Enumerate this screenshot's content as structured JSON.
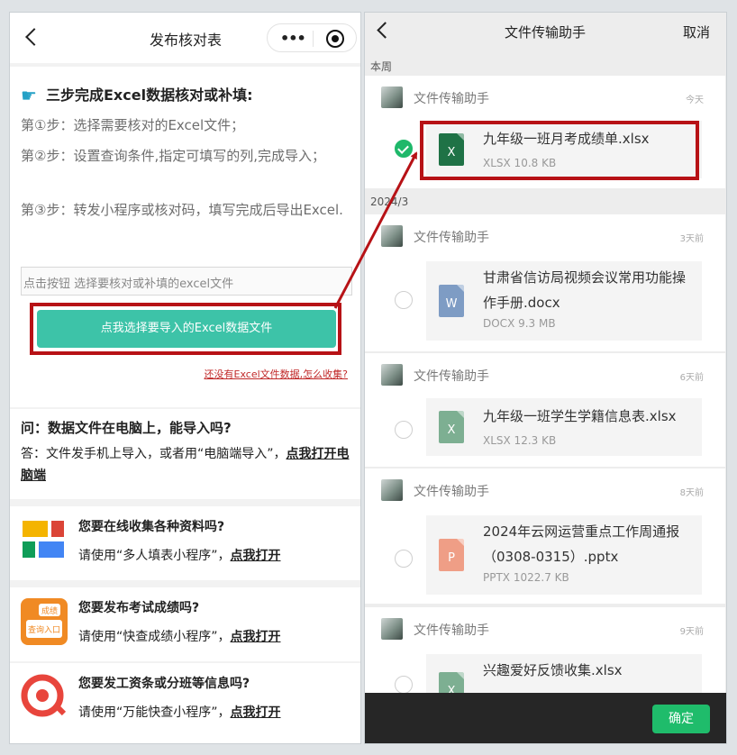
{
  "left": {
    "title": "发布核对表",
    "capsule_dots": "•••",
    "steps_title": "三步完成Excel数据核对或补填:",
    "steps": [
      "第①步：选择需要核对的Excel文件；",
      "第②步：设置查询条件,指定可填写的列,完成导入；",
      "第③步：转发小程序或核对码，填写完成后导出Excel."
    ],
    "file_placeholder": "点击按钮 选择要核对或补填的excel文件",
    "import_button": "点我选择要导入的Excel数据文件",
    "help_link": "还没有Excel文件数据,怎么收集?",
    "faq": {
      "question": "问：数据文件在电脑上，能导入吗?",
      "answer_prefix": "答：文件发手机上导入，或者用“电脑端导入”，",
      "answer_link": "点我打开电脑端"
    },
    "promos": [
      {
        "title": "您要在线收集各种资料吗?",
        "desc": "请使用“多人填表小程序”，",
        "link": "点我打开"
      },
      {
        "title": "您要发布考试成绩吗?",
        "desc": "请使用“快查成绩小程序”，",
        "link": "点我打开",
        "icon_text": "成绩",
        "icon_sub": "查询入口"
      },
      {
        "title": "您要发工资条或分班等信息吗?",
        "desc": "请使用“万能快查小程序”，",
        "link": "点我打开"
      }
    ]
  },
  "right": {
    "title": "文件传输助手",
    "cancel": "取消",
    "confirm": "确定",
    "sections": [
      "本周",
      "2024/3"
    ],
    "messages": [
      {
        "sender": "文件传输助手",
        "time": "今天",
        "file": "九年级一班月考成绩单.xlsx",
        "meta": "XLSX 10.8 KB",
        "icon": "X",
        "selected": true
      },
      {
        "sender": "文件传输助手",
        "time": "3天前",
        "file": "甘肃省信访局视频会议常用功能操作手册.docx",
        "meta": "DOCX 9.3 MB",
        "icon": "W",
        "selected": false
      },
      {
        "sender": "文件传输助手",
        "time": "6天前",
        "file": "九年级一班学生学籍信息表.xlsx",
        "meta": "XLSX 12.3 KB",
        "icon": "X",
        "selected": false
      },
      {
        "sender": "文件传输助手",
        "time": "8天前",
        "file": "2024年云网运营重点工作周通报（0308-0315）.pptx",
        "meta": "PPTX 1022.7 KB",
        "icon": "P",
        "selected": false
      },
      {
        "sender": "文件传输助手",
        "time": "9天前",
        "file": "兴趣爱好反馈收集.xlsx",
        "meta": "",
        "icon": "X",
        "selected": false
      }
    ]
  },
  "colors": {
    "accent_green": "#3dc3a8",
    "highlight_red": "#b71216",
    "wechat_green": "#1fbc6b"
  }
}
